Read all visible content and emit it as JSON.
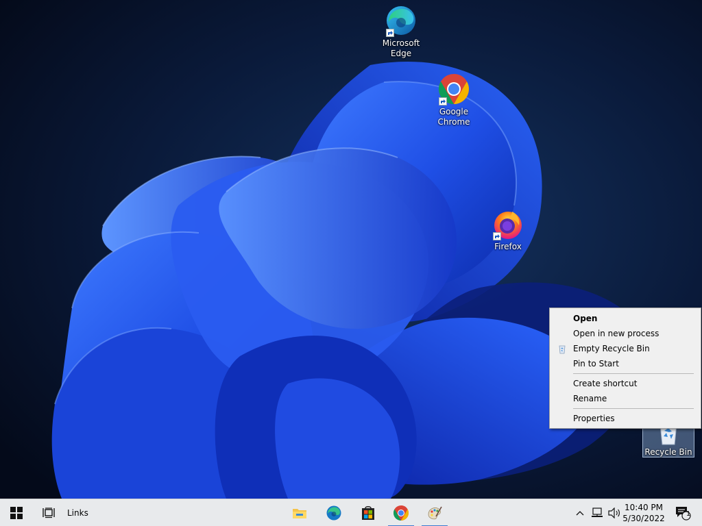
{
  "desktop": {
    "icons": {
      "edge": {
        "label": "Microsoft Edge",
        "icon": "edge-icon"
      },
      "chrome": {
        "label": "Google Chrome",
        "icon": "chrome-icon"
      },
      "firefox": {
        "label": "Firefox",
        "icon": "firefox-icon"
      },
      "recycle_bin": {
        "label": "Recycle Bin",
        "icon": "recycle-bin-icon",
        "selected": true
      }
    }
  },
  "context_menu": {
    "open": "Open",
    "open_new_process": "Open in new process",
    "empty_recycle_bin": "Empty Recycle Bin",
    "pin_to_start": "Pin to Start",
    "create_shortcut": "Create shortcut",
    "rename": "Rename",
    "properties": "Properties"
  },
  "taskbar": {
    "links_label": "Links",
    "apps": [
      "file-explorer-icon",
      "edge-icon",
      "store-icon",
      "chrome-icon",
      "paint-icon"
    ],
    "clock": {
      "time": "10:40 PM",
      "date": "5/30/2022"
    },
    "notification_count": "1"
  },
  "colors": {
    "taskbar": "#e8eaec",
    "menu": "#f0f0f0",
    "accent": "#3b7bd0"
  }
}
